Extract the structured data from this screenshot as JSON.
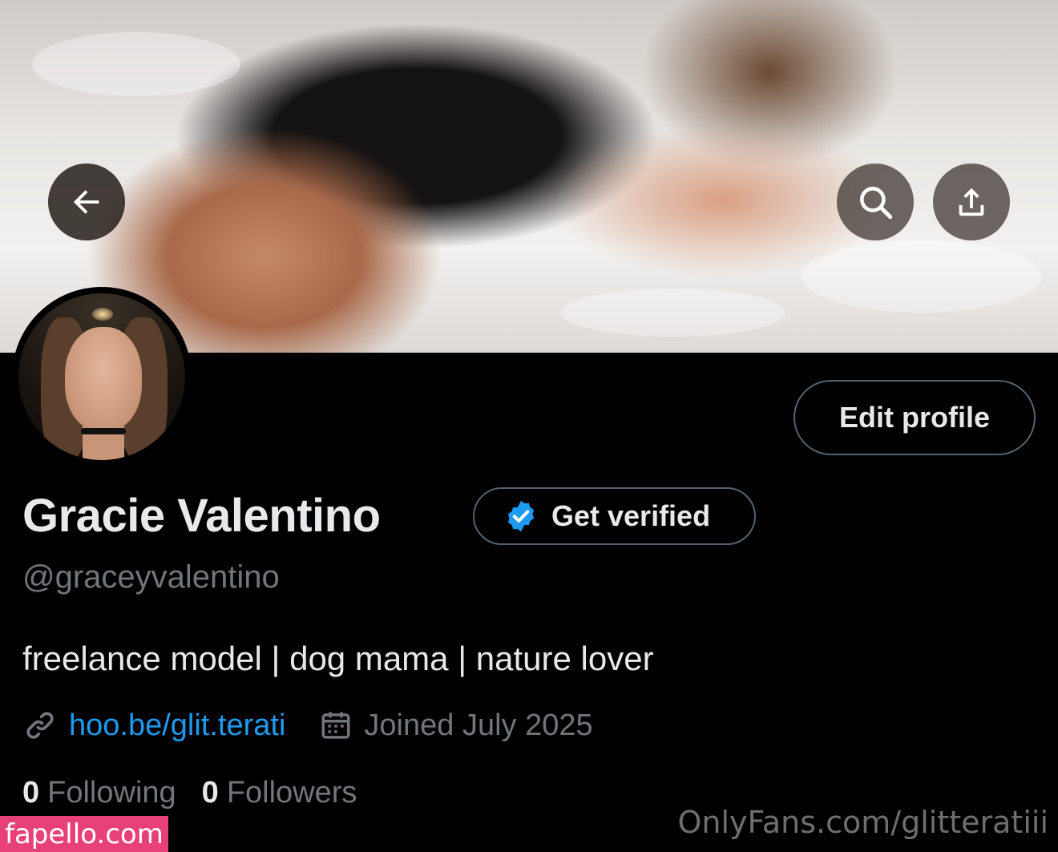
{
  "profile": {
    "display_name": "Gracie Valentino",
    "handle": "@graceyvalentino",
    "bio": "freelance model | dog mama | nature lover",
    "link": "hoo.be/glit.terati",
    "joined": "Joined July 2025"
  },
  "buttons": {
    "edit_profile": "Edit profile",
    "get_verified": "Get verified"
  },
  "stats": {
    "following_count": "0",
    "following_label": "Following",
    "followers_count": "0",
    "followers_label": "Followers"
  },
  "icons": {
    "back": "arrow-left-icon",
    "search": "search-icon",
    "share": "share-icon",
    "verified": "verified-badge-icon",
    "link": "link-icon",
    "calendar": "calendar-icon"
  },
  "watermarks": {
    "left": "fapello.com",
    "right": "OnlyFans.com/glitteratiii"
  },
  "colors": {
    "background": "#000000",
    "accent": "#1d9bf0",
    "muted": "#71767b",
    "border": "#536471",
    "watermark_badge": "#e8417a"
  }
}
